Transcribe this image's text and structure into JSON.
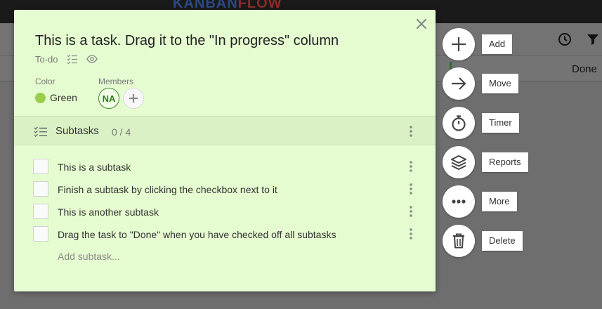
{
  "app": {
    "logo_left": "KANBAN",
    "logo_right": "FLOW",
    "column_done": "Done"
  },
  "task": {
    "title": "This is a task. Drag it to the \"In progress\" column",
    "column": "To-do",
    "color_label": "Color",
    "color_name": "Green",
    "color_hex": "#9acd4a",
    "members_label": "Members",
    "members": [
      {
        "initials": "NA"
      }
    ]
  },
  "subtasks": {
    "title": "Subtasks",
    "count": "0 / 4",
    "items": [
      {
        "text": "This is a subtask",
        "done": false
      },
      {
        "text": "Finish a subtask by clicking the checkbox next to it",
        "done": false
      },
      {
        "text": "This is another subtask",
        "done": false
      },
      {
        "text": "Drag the task to \"Done\" when you have checked off all subtasks",
        "done": false
      }
    ],
    "add_placeholder": "Add subtask..."
  },
  "actions": [
    {
      "label": "Add",
      "icon": "plus-icon"
    },
    {
      "label": "Move",
      "icon": "arrow-right-icon"
    },
    {
      "label": "Timer",
      "icon": "stopwatch-icon"
    },
    {
      "label": "Reports",
      "icon": "layers-icon"
    },
    {
      "label": "More",
      "icon": "ellipsis-icon"
    },
    {
      "label": "Delete",
      "icon": "trash-icon"
    }
  ],
  "icons": {
    "close": "close-icon",
    "header_clock": "clock-icon",
    "header_filter": "filter-icon"
  }
}
